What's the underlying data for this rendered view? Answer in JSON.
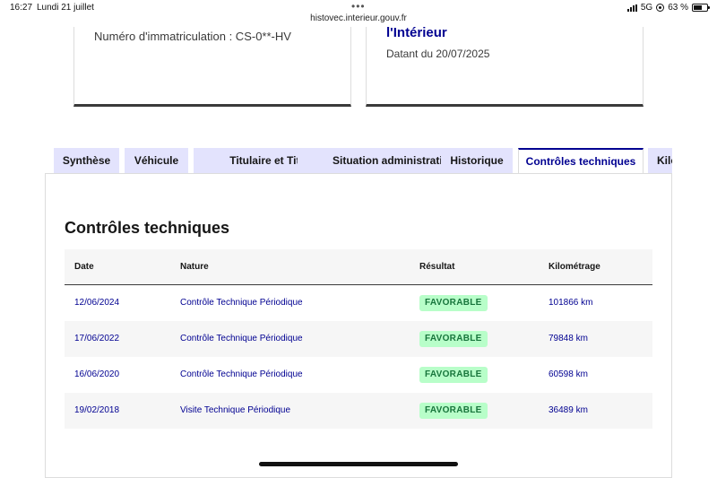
{
  "status_bar": {
    "time": "16:27",
    "date": "Lundi 21 juillet",
    "url": "histovec.interieur.gouv.fr",
    "network": "5G",
    "battery": "63 %",
    "battery_level": 0.63
  },
  "cards": {
    "left_plate": "Numéro d'immatriculation : CS-0**-HV",
    "right_title": "l'Intérieur",
    "right_dated": "Datant du 20/07/2025"
  },
  "tabs": [
    {
      "label": "Synthèse"
    },
    {
      "label": "Véhicule"
    },
    {
      "label": "Titulaire et Titre"
    },
    {
      "label": "Situation administrative"
    },
    {
      "label": "Historique"
    },
    {
      "label": "Contrôles techniques"
    },
    {
      "label": "Kilo"
    }
  ],
  "section": {
    "title": "Contrôles techniques"
  },
  "table": {
    "headers": {
      "date": "Date",
      "nature": "Nature",
      "result": "Résultat",
      "km": "Kilométrage"
    },
    "rows": [
      {
        "date": "12/06/2024",
        "nature": "Contrôle Technique Périodique",
        "result": "FAVORABLE",
        "km": "101866 km"
      },
      {
        "date": "17/06/2022",
        "nature": "Contrôle Technique Périodique",
        "result": "FAVORABLE",
        "km": "79848 km"
      },
      {
        "date": "16/06/2020",
        "nature": "Contrôle Technique Périodique",
        "result": "FAVORABLE",
        "km": "60598 km"
      },
      {
        "date": "19/02/2018",
        "nature": "Visite Technique Périodique",
        "result": "FAVORABLE",
        "km": "36489 km"
      }
    ]
  },
  "colors": {
    "accent": "#000091",
    "tab_bg": "#e3e3fd",
    "success_bg": "#b8fec9",
    "success_text": "#18753c"
  }
}
